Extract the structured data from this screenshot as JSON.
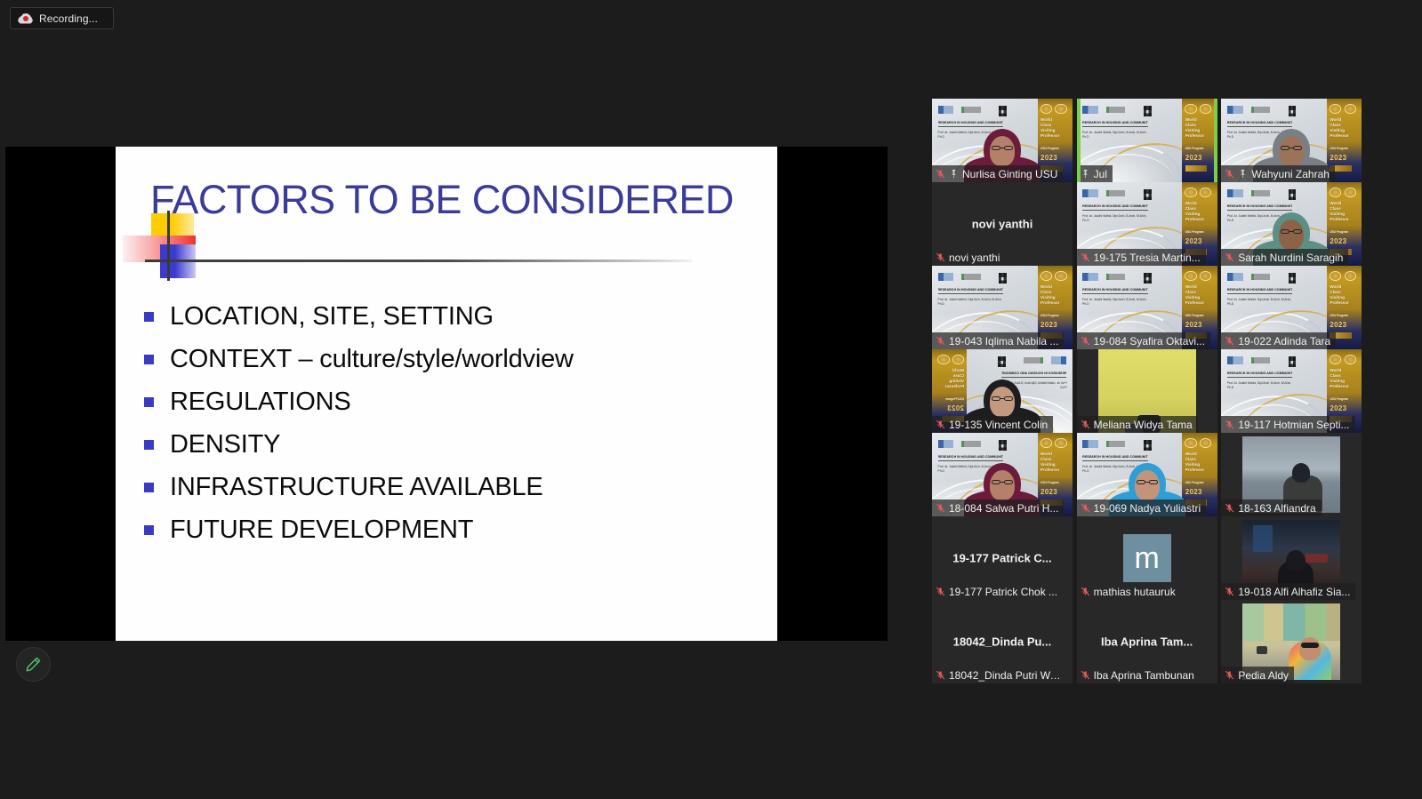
{
  "recording": {
    "label": "Recording...",
    "icon": "recording-cloud-icon"
  },
  "annotate": {
    "icon": "pen-icon",
    "tooltip": "Annotate"
  },
  "slide": {
    "title": "FACTORS TO BE CONSIDERED",
    "title_color": "#3b3b99",
    "bullet_color": "#3a3ac4",
    "bullets": [
      "LOCATION, SITE, SETTING",
      "CONTEXT – culture/style/worldview",
      "REGULATIONS",
      "DENSITY",
      "INFRASTRUCTURE AVAILABLE",
      "FUTURE DEVELOPMENT"
    ]
  },
  "poster": {
    "title": "RESEARCH IN HOUSING AND COMMUNITY",
    "presenter": "Prof. Ar. Julaihi Wahid, Dipl.Arch, B.Arch, M.Arch, Ph.D",
    "banner_lines": "World Class Visiting Professor",
    "banner_sub": "USU Program",
    "year": "2023"
  },
  "grid": {
    "active_speaker_border": "#f6ee63",
    "video_on_border": "#7ad04a",
    "participants": [
      {
        "name": "Nurlisa Ginting USU",
        "muted": true,
        "pinned": true,
        "video": "poster-person",
        "display": "video"
      },
      {
        "name": "Jul",
        "muted": false,
        "pinned": true,
        "video": "poster",
        "display": "video",
        "active": true
      },
      {
        "name": "Wahyuni Zahrah",
        "muted": true,
        "pinned": true,
        "video": "poster-person",
        "display": "video"
      },
      {
        "name": "novi yanthi",
        "muted": true,
        "pinned": false,
        "video": "none",
        "display": "name",
        "center_label": "novi yanthi"
      },
      {
        "name": "19-175 Tresia Martin...",
        "muted": true,
        "pinned": false,
        "video": "poster",
        "display": "video"
      },
      {
        "name": "Sarah Nurdini Saragih",
        "muted": true,
        "pinned": false,
        "video": "poster-person",
        "display": "video"
      },
      {
        "name": "19-043 Iqlima Nabila ...",
        "muted": true,
        "pinned": false,
        "video": "poster",
        "display": "video"
      },
      {
        "name": "19-084 Syafira Oktavi...",
        "muted": true,
        "pinned": false,
        "video": "poster",
        "display": "video"
      },
      {
        "name": "19-022 Adinda Tara",
        "muted": true,
        "pinned": false,
        "video": "poster",
        "display": "video"
      },
      {
        "name": "19-135 Vincent Colin",
        "muted": true,
        "pinned": false,
        "video": "poster-person-mirrored",
        "display": "video"
      },
      {
        "name": "Meliana Widya Tama",
        "muted": true,
        "pinned": false,
        "video": "yellow-wall",
        "display": "video"
      },
      {
        "name": "19-117 Hotmian Septi...",
        "muted": true,
        "pinned": false,
        "video": "poster",
        "display": "video"
      },
      {
        "name": "18-084 Salwa Putri H...",
        "muted": true,
        "pinned": false,
        "video": "poster-person",
        "display": "video"
      },
      {
        "name": "19-069 Nadya Yuliastri",
        "muted": true,
        "pinned": false,
        "video": "poster-person",
        "display": "video"
      },
      {
        "name": "18-163 Alfiandra",
        "muted": true,
        "pinned": false,
        "video": "photo-water",
        "display": "photo"
      },
      {
        "name": "19-177 Patrick Chok ...",
        "muted": true,
        "pinned": false,
        "video": "none",
        "display": "name",
        "center_label": "19-177 Patrick C..."
      },
      {
        "name": "mathias hutauruk",
        "muted": true,
        "pinned": false,
        "video": "avatar",
        "display": "avatar",
        "initial": "m"
      },
      {
        "name": "19-018 Alfi Alhafiz Sia...",
        "muted": true,
        "pinned": false,
        "video": "photo-street",
        "display": "photo"
      },
      {
        "name": "18042_Dinda Putri Wa...",
        "muted": true,
        "pinned": false,
        "video": "none",
        "display": "name",
        "center_label": "18042_Dinda Pu..."
      },
      {
        "name": "Iba Aprina Tambunan",
        "muted": true,
        "pinned": false,
        "video": "none",
        "display": "name",
        "center_label": "Iba Aprina Tam..."
      },
      {
        "name": "Pedia Aldy",
        "muted": true,
        "pinned": false,
        "video": "photo-shops",
        "display": "photo"
      }
    ]
  }
}
